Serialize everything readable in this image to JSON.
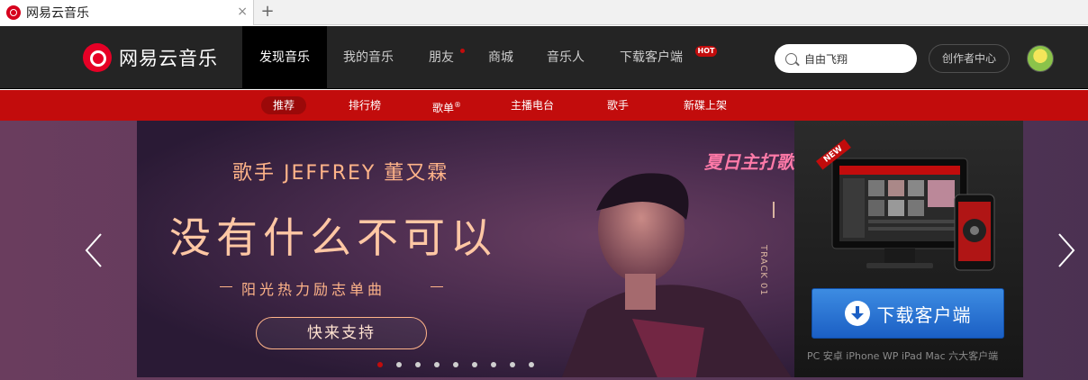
{
  "browser": {
    "tab_title": "网易云音乐",
    "close_glyph": "×",
    "newtab_glyph": "+"
  },
  "header": {
    "logo_text": "网易云音乐",
    "nav": [
      {
        "label": "发现音乐"
      },
      {
        "label": "我的音乐"
      },
      {
        "label": "朋友"
      },
      {
        "label": "商城"
      },
      {
        "label": "音乐人"
      },
      {
        "label": "下载客户端"
      }
    ],
    "hot_badge": "HOT",
    "search_value": "自由飞翔",
    "creator_label": "创作者中心"
  },
  "subnav": {
    "items": [
      {
        "label": "推荐"
      },
      {
        "label": "排行榜"
      },
      {
        "label": "歌单"
      },
      {
        "label": "主播电台"
      },
      {
        "label": "歌手"
      },
      {
        "label": "新碟上架"
      }
    ],
    "playlist_mark": "®"
  },
  "banner": {
    "artist_line": "歌手 JEFFREY 董又霖",
    "headline": "没有什么不可以",
    "subtitle": "阳光热力励志单曲",
    "cta": "快来支持",
    "brand": "夏日主打歌",
    "track": "TRACK 01",
    "slide_count": 9,
    "active_slide": 0
  },
  "download": {
    "ribbon": "NEW",
    "button_label": "下载客户端",
    "caption": "PC 安卓 iPhone WP iPad Mac 六大客户端"
  },
  "colors": {
    "topbar": "#242424",
    "accent": "#c20c0c",
    "banner_text": "#ffb489"
  }
}
